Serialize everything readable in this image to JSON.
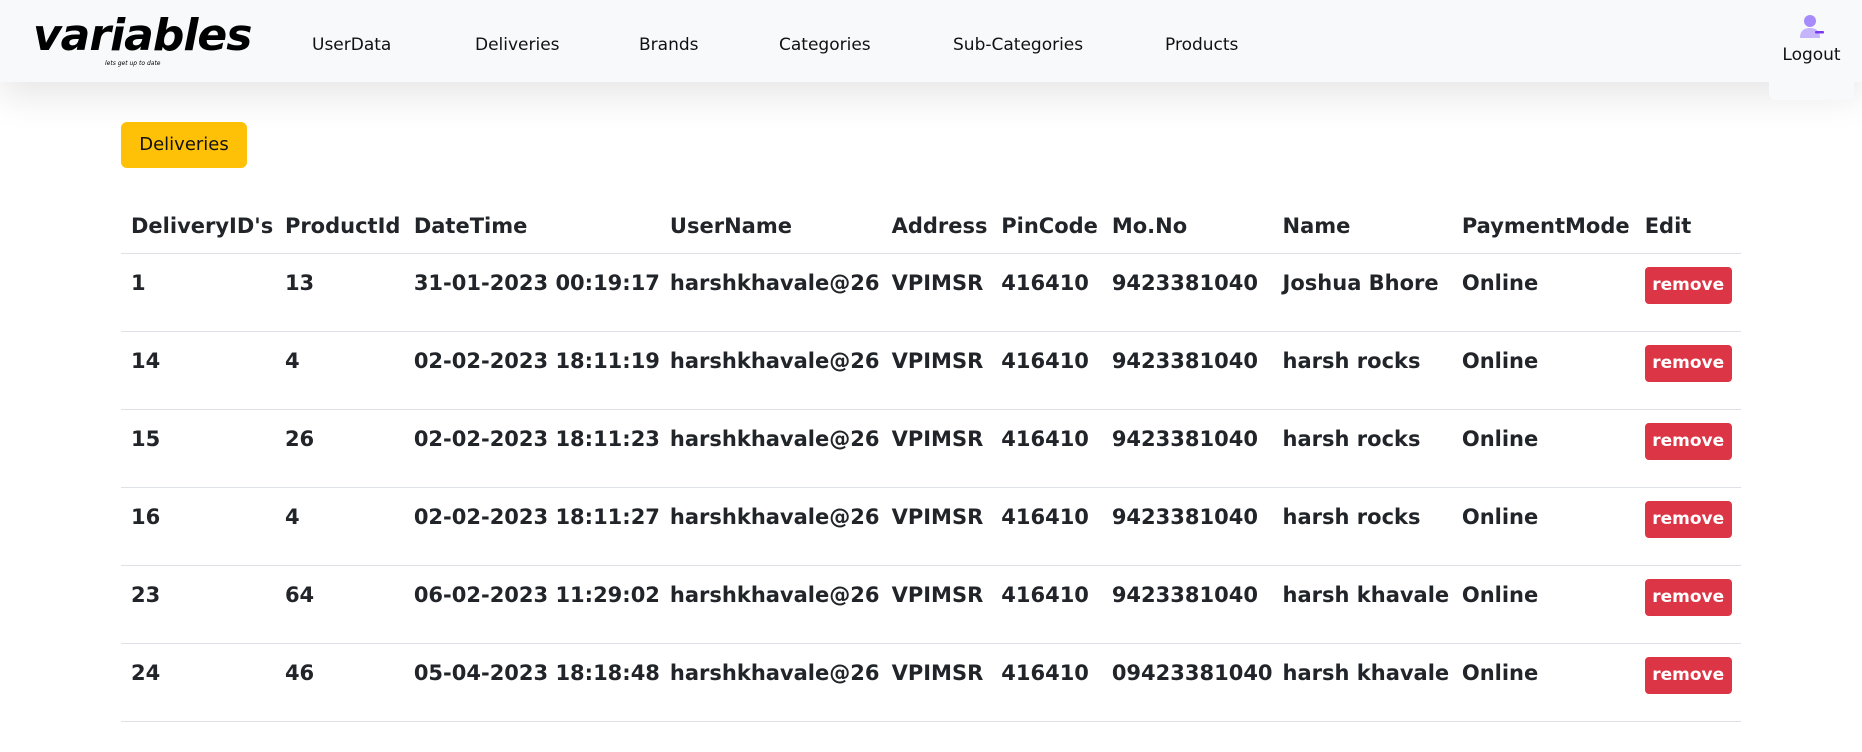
{
  "brand": {
    "name": "variables",
    "tagline": "lets get up to date"
  },
  "nav": {
    "links": [
      "UserData",
      "Deliveries",
      "Brands",
      "Categories",
      "Sub-Categories",
      "Products"
    ],
    "logout_label": "Logout"
  },
  "section_button": "Deliveries",
  "table": {
    "headers": [
      "DeliveryID's",
      "ProductId",
      "DateTime",
      "UserName",
      "Address",
      "PinCode",
      "Mo.No",
      "Name",
      "PaymentMode",
      "Edit"
    ],
    "rows": [
      [
        "1",
        "13",
        "31-01-2023 00:19:17",
        "harshkhavale@26",
        "VPIMSR",
        "416410",
        "9423381040",
        "Joshua Bhore",
        "Online"
      ],
      [
        "14",
        "4",
        "02-02-2023 18:11:19",
        "harshkhavale@26",
        "VPIMSR",
        "416410",
        "9423381040",
        "harsh rocks",
        "Online"
      ],
      [
        "15",
        "26",
        "02-02-2023 18:11:23",
        "harshkhavale@26",
        "VPIMSR",
        "416410",
        "9423381040",
        "harsh rocks",
        "Online"
      ],
      [
        "16",
        "4",
        "02-02-2023 18:11:27",
        "harshkhavale@26",
        "VPIMSR",
        "416410",
        "9423381040",
        "harsh rocks",
        "Online"
      ],
      [
        "23",
        "64",
        "06-02-2023 11:29:02",
        "harshkhavale@26",
        "VPIMSR",
        "416410",
        "9423381040",
        "harsh khavale",
        "Online"
      ],
      [
        "24",
        "46",
        "05-04-2023 18:18:48",
        "harshkhavale@26",
        "VPIMSR",
        "416410",
        "09423381040",
        "harsh khavale",
        "Online"
      ]
    ],
    "remove_label": "remove"
  },
  "colors": {
    "accent_yellow": "#ffc107",
    "danger_red": "#dc3545",
    "navbar_bg": "#f8f9fa",
    "user_icon": "#a78bfa"
  },
  "icons": {
    "user": "user-icon"
  }
}
